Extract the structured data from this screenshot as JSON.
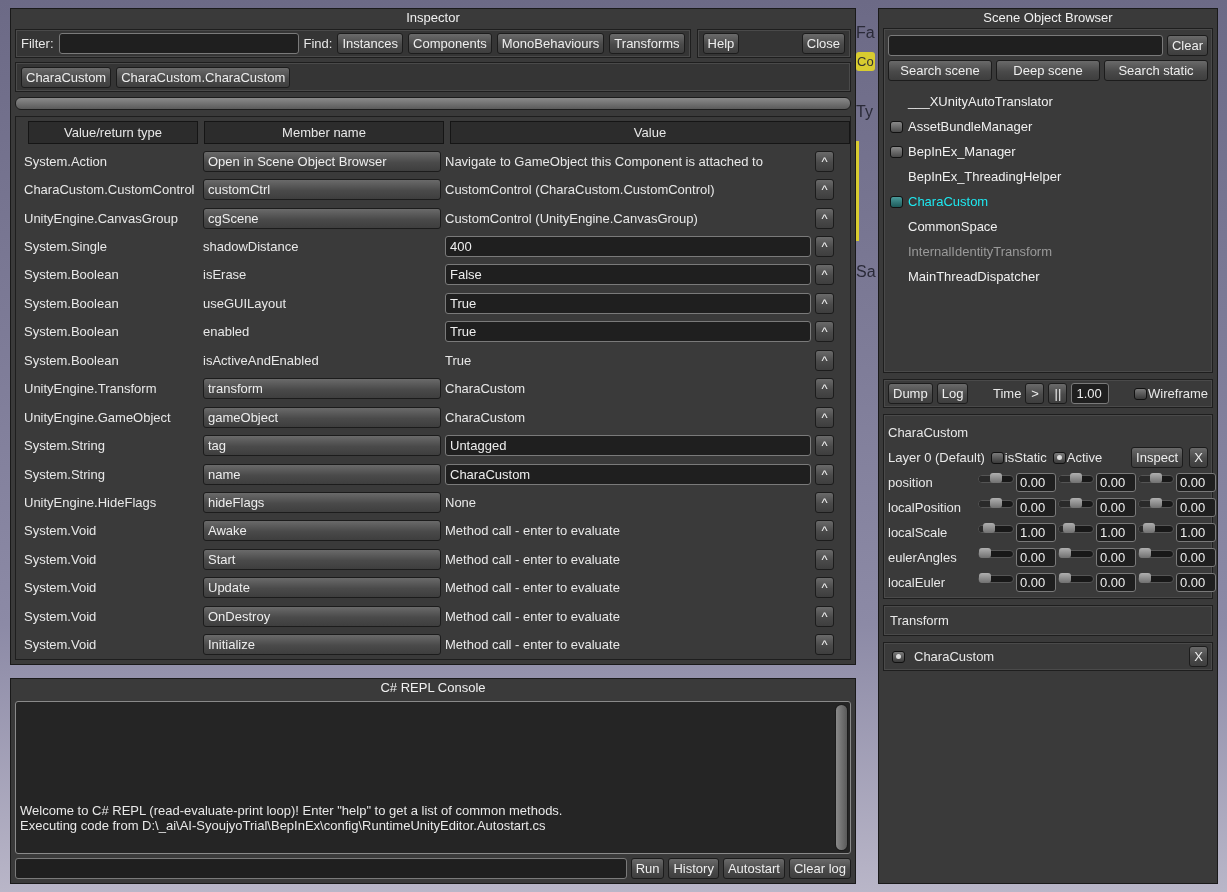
{
  "background": {
    "fragments": [
      {
        "kind": "heading",
        "text": "Fa"
      },
      {
        "kind": "chip",
        "text": "Co"
      },
      {
        "kind": "heading",
        "text": "Ty"
      },
      {
        "kind": "bar"
      },
      {
        "kind": "heading",
        "text": "Sa"
      }
    ]
  },
  "inspector": {
    "title": "Inspector",
    "filter_label": "Filter:",
    "find_label": "Find:",
    "find_buttons": [
      "Instances",
      "Components",
      "MonoBehaviours",
      "Transforms"
    ],
    "window_buttons": [
      "Help",
      "Close"
    ],
    "breadcrumbs": [
      "CharaCustom",
      "CharaCustom.CharaCustom"
    ],
    "table": {
      "columns": [
        "Value/return type",
        "Member name",
        "Value"
      ],
      "rows": [
        {
          "type": "System.Action",
          "member": {
            "kind": "button",
            "text": "Open in Scene Object Browser"
          },
          "value": {
            "kind": "text",
            "text": "Navigate to GameObject this Component is attached to"
          },
          "action": "^"
        },
        {
          "type": "CharaCustom.CustomControl",
          "member": {
            "kind": "button",
            "text": "customCtrl"
          },
          "value": {
            "kind": "text",
            "text": "CustomControl (CharaCustom.CustomControl)"
          },
          "action": "^"
        },
        {
          "type": "UnityEngine.CanvasGroup",
          "member": {
            "kind": "button",
            "text": "cgScene"
          },
          "value": {
            "kind": "text",
            "text": "CustomControl (UnityEngine.CanvasGroup)"
          },
          "action": "^"
        },
        {
          "type": "System.Single",
          "member": {
            "kind": "text",
            "text": "shadowDistance"
          },
          "value": {
            "kind": "field",
            "text": "400"
          },
          "action": "^"
        },
        {
          "type": "System.Boolean",
          "member": {
            "kind": "text",
            "text": "isErase"
          },
          "value": {
            "kind": "field",
            "text": "False"
          },
          "action": "^"
        },
        {
          "type": "System.Boolean",
          "member": {
            "kind": "text",
            "text": "useGUILayout"
          },
          "value": {
            "kind": "field",
            "text": "True"
          },
          "action": "^"
        },
        {
          "type": "System.Boolean",
          "member": {
            "kind": "text",
            "text": "enabled"
          },
          "value": {
            "kind": "field",
            "text": "True"
          },
          "action": "^"
        },
        {
          "type": "System.Boolean",
          "member": {
            "kind": "text",
            "text": "isActiveAndEnabled"
          },
          "value": {
            "kind": "text",
            "text": "True"
          },
          "action": "^"
        },
        {
          "type": "UnityEngine.Transform",
          "member": {
            "kind": "button",
            "text": "transform"
          },
          "value": {
            "kind": "text",
            "text": "CharaCustom"
          },
          "action": "^"
        },
        {
          "type": "UnityEngine.GameObject",
          "member": {
            "kind": "button",
            "text": "gameObject"
          },
          "value": {
            "kind": "text",
            "text": "CharaCustom"
          },
          "action": "^"
        },
        {
          "type": "System.String",
          "member": {
            "kind": "button",
            "text": "tag"
          },
          "value": {
            "kind": "field",
            "text": "Untagged"
          },
          "action": "^"
        },
        {
          "type": "System.String",
          "member": {
            "kind": "button",
            "text": "name"
          },
          "value": {
            "kind": "field",
            "text": "CharaCustom"
          },
          "action": "^"
        },
        {
          "type": "UnityEngine.HideFlags",
          "member": {
            "kind": "button",
            "text": "hideFlags"
          },
          "value": {
            "kind": "text",
            "text": "None"
          },
          "action": "^"
        },
        {
          "type": "System.Void",
          "member": {
            "kind": "button",
            "text": "Awake"
          },
          "value": {
            "kind": "text",
            "text": "Method call - enter to evaluate"
          },
          "action": "^"
        },
        {
          "type": "System.Void",
          "member": {
            "kind": "button",
            "text": "Start"
          },
          "value": {
            "kind": "text",
            "text": "Method call - enter to evaluate"
          },
          "action": "^"
        },
        {
          "type": "System.Void",
          "member": {
            "kind": "button",
            "text": "Update"
          },
          "value": {
            "kind": "text",
            "text": "Method call - enter to evaluate"
          },
          "action": "^"
        },
        {
          "type": "System.Void",
          "member": {
            "kind": "button",
            "text": "OnDestroy"
          },
          "value": {
            "kind": "text",
            "text": "Method call - enter to evaluate"
          },
          "action": "^"
        },
        {
          "type": "System.Void",
          "member": {
            "kind": "button",
            "text": "Initialize"
          },
          "value": {
            "kind": "text",
            "text": "Method call - enter to evaluate"
          },
          "action": "^"
        }
      ]
    }
  },
  "repl": {
    "title": "C# REPL Console",
    "log": [
      "Welcome to C# REPL (read-evaluate-print loop)! Enter \"help\" to get a list of common methods.",
      "Executing code from D:\\_ai\\AI-SyoujyoTrial\\BepInEx\\config\\RuntimeUnityEditor.Autostart.cs"
    ],
    "buttons": [
      "Run",
      "History",
      "Autostart",
      "Clear log"
    ]
  },
  "scene_browser": {
    "title": "Scene Object Browser",
    "clear_button": "Clear",
    "search_buttons": [
      "Search scene",
      "Deep scene",
      "Search static"
    ],
    "objects": [
      {
        "name": "___XUnityAutoTranslator",
        "has_children": false,
        "selected": false,
        "active": true
      },
      {
        "name": "AssetBundleManager",
        "has_children": true,
        "selected": false,
        "active": true
      },
      {
        "name": "BepInEx_Manager",
        "has_children": true,
        "selected": false,
        "active": true
      },
      {
        "name": "BepInEx_ThreadingHelper",
        "has_children": false,
        "selected": false,
        "active": true
      },
      {
        "name": "CharaCustom",
        "has_children": true,
        "selected": true,
        "active": true
      },
      {
        "name": "CommonSpace",
        "has_children": false,
        "selected": false,
        "active": true
      },
      {
        "name": "InternalIdentityTransform",
        "has_children": false,
        "selected": false,
        "active": false
      },
      {
        "name": "MainThreadDispatcher",
        "has_children": false,
        "selected": false,
        "active": true
      }
    ],
    "toolbar": {
      "buttons": [
        "Dump",
        "Log"
      ],
      "time_label": "Time",
      "time_buttons": [
        ">",
        "||"
      ],
      "time_value": "1.00",
      "wireframe_label": "Wireframe",
      "wireframe": false
    },
    "object": {
      "name": "CharaCustom",
      "layer": "Layer 0 (Default)",
      "is_static_label": "isStatic",
      "is_static": false,
      "active_label": "Active",
      "active": true,
      "inspect_button": "Inspect",
      "close_button": "X",
      "vectors": [
        {
          "label": "position",
          "axes": [
            {
              "level": 0.5,
              "value": "0.00"
            },
            {
              "level": 0.5,
              "value": "0.00"
            },
            {
              "level": 0.5,
              "value": "0.00"
            }
          ]
        },
        {
          "label": "localPosition",
          "axes": [
            {
              "level": 0.5,
              "value": "0.00"
            },
            {
              "level": 0.5,
              "value": "0.00"
            },
            {
              "level": 0.5,
              "value": "0.00"
            }
          ]
        },
        {
          "label": "localScale",
          "axes": [
            {
              "level": 0.2,
              "value": "1.00"
            },
            {
              "level": 0.2,
              "value": "1.00"
            },
            {
              "level": 0.2,
              "value": "1.00"
            }
          ]
        },
        {
          "label": "eulerAngles",
          "axes": [
            {
              "level": 0,
              "value": "0.00"
            },
            {
              "level": 0,
              "value": "0.00"
            },
            {
              "level": 0,
              "value": "0.00"
            }
          ]
        },
        {
          "label": "localEuler",
          "axes": [
            {
              "level": 0,
              "value": "0.00"
            },
            {
              "level": 0,
              "value": "0.00"
            },
            {
              "level": 0,
              "value": "0.00"
            }
          ]
        }
      ]
    },
    "components": [
      {
        "kind": "header",
        "name": "Transform"
      },
      {
        "kind": "toggle",
        "name": "CharaCustom",
        "enabled": true,
        "remove_button": "X"
      }
    ]
  }
}
